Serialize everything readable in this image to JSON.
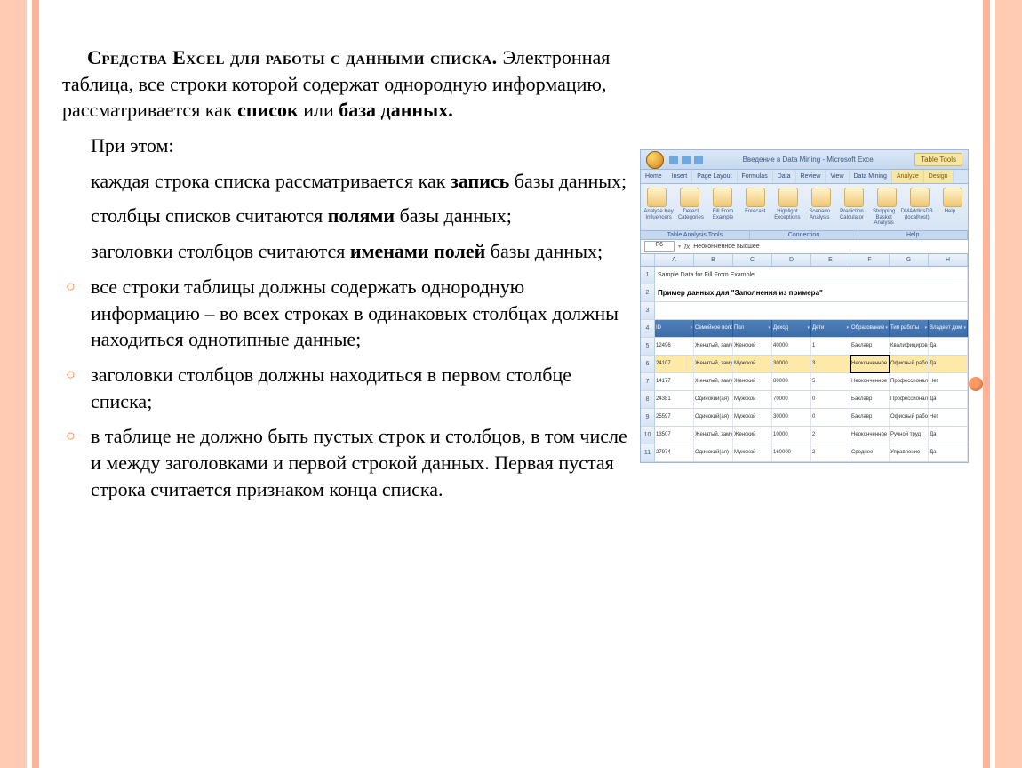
{
  "text": {
    "title_part1": "Средства Excel для работы с данными списка. ",
    "title_part2": "Электронная таблица, все строки которой содержат однородную информацию, рассматривается как ",
    "bold_spisok": "список",
    "or": " или ",
    "bold_baza": "база данных.",
    "pre_list": "При этом:",
    "item1a": "каждая строка списка рассматривается как ",
    "item1b": "запись",
    "item1c": " базы данных;",
    "item2a": "столбцы списков считаются ",
    "item2b": "полями",
    "item2c": " базы данных;",
    "item3a": "заголовки столбцов считаются ",
    "item3b": "именами полей",
    "item3c": " базы данных;",
    "bullet1": "все строки таблицы должны содержать однородную информацию – во всех строках в одинаковых столбцах должны находиться однотипные данные;",
    "bullet2": "заголовки столбцов должны находиться в первом столбце списка;",
    "bullet3": "в таблице не должно быть пустых строк и столбцов, в том числе и между заголовками и первой строкой данных. Первая пустая строка считается признаком конца списка."
  },
  "excel": {
    "title": "Введение в Data Mining - Microsoft Excel",
    "tabletools": "Table Tools",
    "tabs": [
      "Home",
      "Insert",
      "Page Layout",
      "Formulas",
      "Data",
      "Review",
      "View",
      "Data Mining",
      "Analyze",
      "Design"
    ],
    "active_tab_index": 8,
    "ribbon_labels": [
      "Analyze Key Influencers",
      "Detect Categories",
      "Fill From Example",
      "Forecast",
      "Highlight Exceptions",
      "Scenario Analysis",
      "Prediction Calculator",
      "Shopping Basket Analysis",
      "DMAddinsDB (localhost)",
      "Help"
    ],
    "groups": [
      "Table Analysis Tools",
      "Connection",
      "Help"
    ],
    "namebox": "F6",
    "formula": "Неоконченное высшее",
    "columns": [
      "A",
      "B",
      "C",
      "D",
      "E",
      "F",
      "G",
      "H"
    ],
    "row1_text": "Sample Data for Fill From Example",
    "row2_text": "Пример данных для \"Заполнения из примера\"",
    "headers": [
      "ID",
      "Семейное поло",
      "Пол",
      "Доход",
      "Дети",
      "Образование",
      "Тип работы",
      "Владеет дом"
    ],
    "data_rows": [
      {
        "n": 5,
        "cells": [
          "12496",
          "Женатый, замуже",
          "Женский",
          "40000",
          "1",
          "Баклавр",
          "Квалифициров",
          "Да"
        ]
      },
      {
        "n": 6,
        "cells": [
          "24107",
          "Женатый, замуже",
          "Мужской",
          "30000",
          "3",
          "Неоконченное выс",
          "Офисный работ",
          "Да"
        ],
        "hl": true,
        "sel": 5
      },
      {
        "n": 7,
        "cells": [
          "14177",
          "Женатый, замуже",
          "Женский",
          "80000",
          "5",
          "Неоконченное выс",
          "Профессионал",
          "Нет"
        ]
      },
      {
        "n": 8,
        "cells": [
          "24381",
          "Одинокий(ая)",
          "Мужской",
          "70000",
          "0",
          "Баклавр",
          "Профессионал",
          "Да"
        ]
      },
      {
        "n": 9,
        "cells": [
          "25597",
          "Одинокий(ая)",
          "Мужской",
          "30000",
          "0",
          "Баклавр",
          "Офисный работ",
          "Нет"
        ]
      },
      {
        "n": 10,
        "cells": [
          "13507",
          "Женатый, замуже",
          "Женский",
          "10000",
          "2",
          "Неоконченное выс",
          "Ручной труд",
          "Да"
        ]
      },
      {
        "n": 11,
        "cells": [
          "27974",
          "Одинокий(ая)",
          "Мужской",
          "160000",
          "2",
          "Среднее",
          "Управление",
          "Да"
        ]
      }
    ]
  }
}
